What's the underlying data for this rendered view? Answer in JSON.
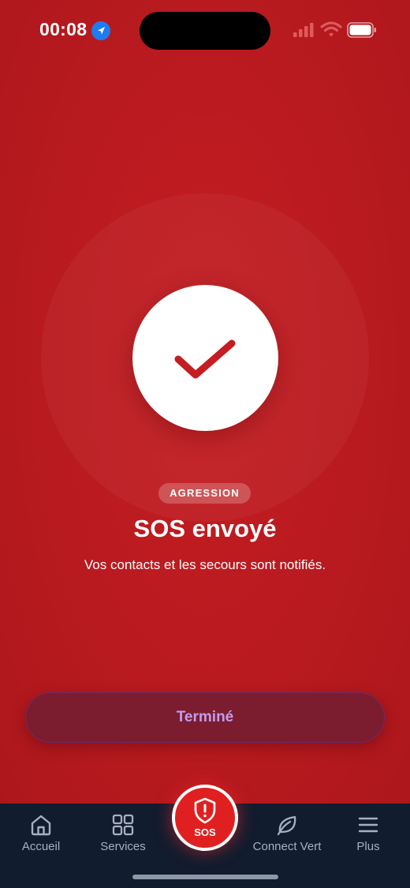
{
  "status_bar": {
    "time": "00:08",
    "icons": [
      "location-arrow-icon",
      "signal-icon",
      "wifi-icon",
      "battery-icon"
    ]
  },
  "confirmation": {
    "icon": "checkmark-icon",
    "category_badge": "AGRESSION",
    "title": "SOS envoyé",
    "message": "Vos contacts et les secours sont notifiés."
  },
  "actions": {
    "done_label": "Terminé"
  },
  "tab_bar": {
    "home": "Accueil",
    "services": "Services",
    "sos": "SOS",
    "green": "Connect Vert",
    "more": "Plus"
  },
  "colors": {
    "background": "#b81a1f",
    "button": "#7c1c2f",
    "button_text": "#c09cf0",
    "tab_bar": "#111c2e",
    "sos_accent": "#e02020"
  }
}
